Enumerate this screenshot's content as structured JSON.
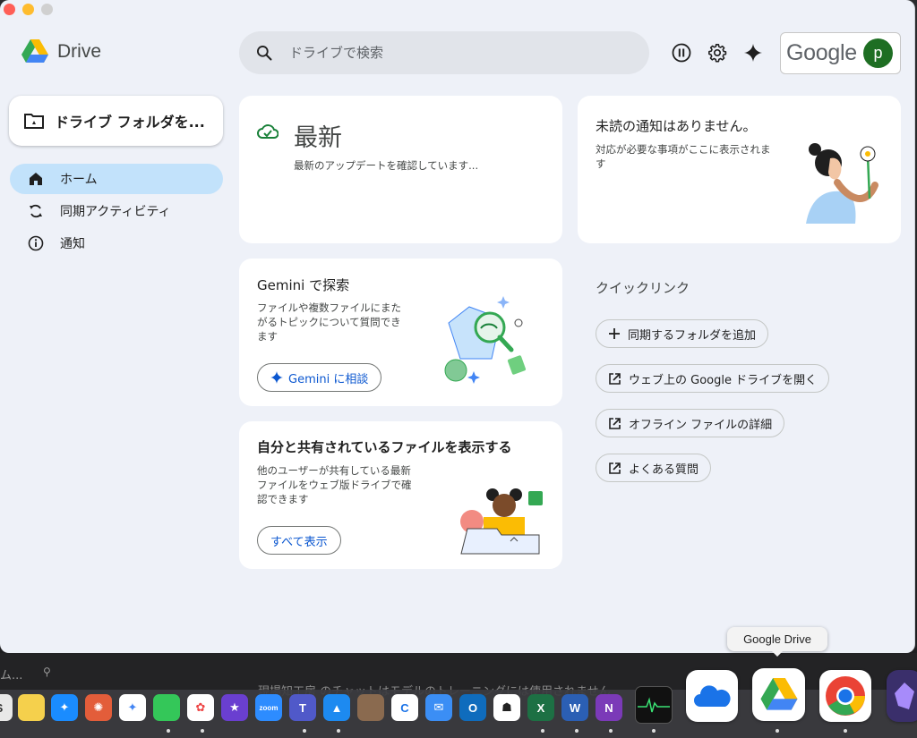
{
  "app": {
    "name": "Drive"
  },
  "search": {
    "placeholder": "ドライブで検索"
  },
  "account": {
    "brand": "Google",
    "avatar_letter": "p"
  },
  "sidebar": {
    "new_button": "ドライブ フォルダを...",
    "items": [
      {
        "label": "ホーム",
        "icon": "home-icon",
        "active": true
      },
      {
        "label": "同期アクティビティ",
        "icon": "sync-icon",
        "active": false
      },
      {
        "label": "通知",
        "icon": "info-icon",
        "active": false
      }
    ]
  },
  "status_card": {
    "title": "最新",
    "text": "最新のアップデートを確認しています..."
  },
  "notification_card": {
    "title": "未読の通知はありません。",
    "text_line1": "対応が必要な事項がここに表示されま",
    "text_line2": "す"
  },
  "gemini_card": {
    "title": "Gemini で探索",
    "text_line1": "ファイルや複数ファイルにまた",
    "text_line2": "がるトピックについて質問でき",
    "text_line3": "ます",
    "button": "Gemini に相談"
  },
  "shared_card": {
    "title": "自分と共有されているファイルを表示する",
    "text_line1": "他のユーザーが共有している最新",
    "text_line2": "ファイルをウェブ版ドライブで確",
    "text_line3": "認できます",
    "button": "すべて表示"
  },
  "quick_links": {
    "title": "クイックリンク",
    "items": [
      {
        "label": "同期するフォルダを追加",
        "icon": "plus-icon"
      },
      {
        "label": "ウェブ上の Google ドライブを開く",
        "icon": "open-external-icon"
      },
      {
        "label": "オフライン ファイルの詳細",
        "icon": "open-external-icon"
      },
      {
        "label": "よくある質問",
        "icon": "open-external-icon"
      }
    ]
  },
  "tooltip": "Google Drive",
  "background": {
    "left_text": "ム...",
    "mid_text": "現場知工房 のチャットはモデルのトレーニングには使用されません"
  },
  "colors": {
    "accent_blue": "#0b57d0",
    "active_nav": "#c2e2fb",
    "window_bg": "#eef1f8",
    "avatar_green": "#1e6e23"
  }
}
